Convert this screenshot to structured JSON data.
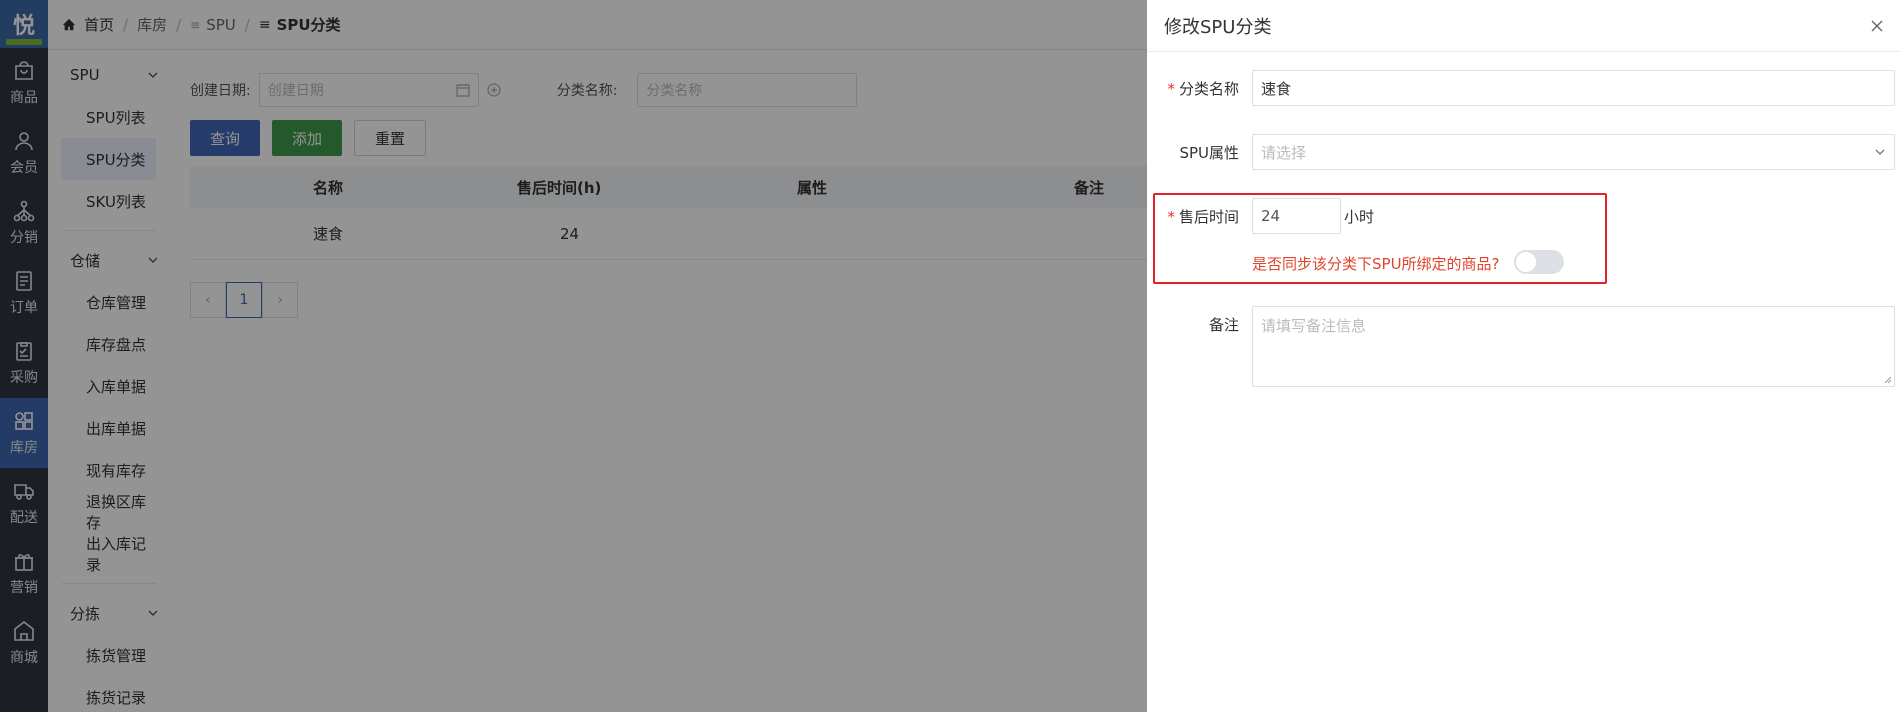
{
  "app": {
    "logo_char": "悦"
  },
  "rail": {
    "items": [
      {
        "label": "商品",
        "icon": "bag-icon"
      },
      {
        "label": "会员",
        "icon": "user-icon"
      },
      {
        "label": "分销",
        "icon": "hierarchy-icon"
      },
      {
        "label": "订单",
        "icon": "document-icon"
      },
      {
        "label": "采购",
        "icon": "clipboard-check-icon"
      },
      {
        "label": "库房",
        "icon": "grid-icon",
        "active": true
      },
      {
        "label": "配送",
        "icon": "truck-icon"
      },
      {
        "label": "营销",
        "icon": "gift-icon"
      },
      {
        "label": "商城",
        "icon": "store-icon"
      }
    ]
  },
  "breadcrumb": {
    "home": "首页",
    "warehouse": "库房",
    "spu": "SPU",
    "current": "SPU分类"
  },
  "submenu": {
    "spu_group": "SPU",
    "spu_list": "SPU列表",
    "spu_category": "SPU分类",
    "sku_list": "SKU列表",
    "storage_group": "仓储",
    "warehouse_mgmt": "仓库管理",
    "stock_check": "库存盘点",
    "inbound": "入库单据",
    "outbound": "出库单据",
    "current_stock": "现有库存",
    "return_stock": "退换区库存",
    "io_records": "出入库记录",
    "picking_group": "分拣",
    "picking_mgmt": "拣货管理",
    "picking_records": "拣货记录"
  },
  "filters": {
    "created_label": "创建日期:",
    "created_placeholder": "创建日期",
    "name_label": "分类名称:",
    "name_placeholder": "分类名称"
  },
  "buttons": {
    "query": "查询",
    "add": "添加",
    "reset": "重置"
  },
  "table": {
    "headers": {
      "name": "名称",
      "after_sale": "售后时间(h)",
      "attr": "属性",
      "remark": "备注"
    },
    "rows": [
      {
        "name": "速食",
        "after_sale": "24",
        "attr": "",
        "remark": ""
      }
    ]
  },
  "pagination": {
    "prev": "‹",
    "page": "1",
    "next": "›"
  },
  "drawer": {
    "title": "修改SPU分类",
    "close_icon": "close-icon",
    "name_label": "分类名称",
    "name_value": "速食",
    "attr_label": "SPU属性",
    "attr_placeholder": "请选择",
    "after_sale_label": "售后时间",
    "after_sale_value": "24",
    "after_sale_unit": "小时",
    "sync_question": "是否同步该分类下SPU所绑定的商品?",
    "sync_enabled": false,
    "remark_label": "备注",
    "remark_placeholder": "请填写备注信息",
    "highlight_color": "#e0222a"
  }
}
